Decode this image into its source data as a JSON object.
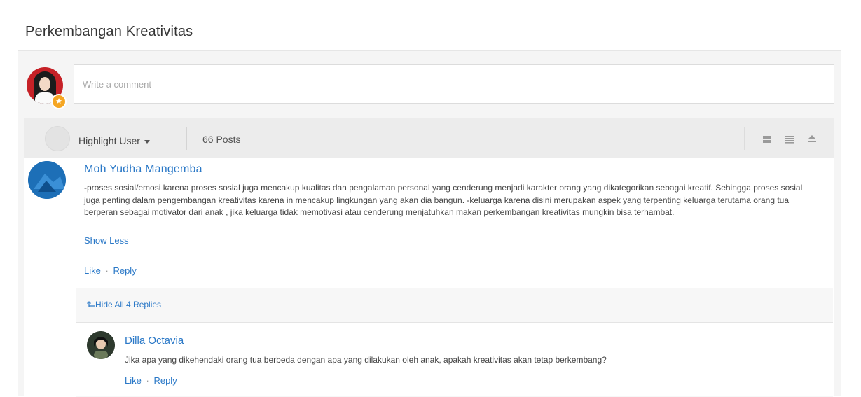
{
  "panel": {
    "title": "Perkembangan Kreativitas"
  },
  "composer": {
    "placeholder": "Write a comment"
  },
  "toolbar": {
    "highlight_label": "Highlight User",
    "posts_count": "66 Posts",
    "view_icons": [
      "list-view-icon",
      "compact-view-icon",
      "collapse-view-icon"
    ]
  },
  "post": {
    "author": "Moh Yudha Mangemba",
    "text": "-proses sosial/emosi karena proses sosial juga mencakup kualitas dan pengalaman personal yang cenderung menjadi karakter orang yang dikategorikan sebagai kreatif. Sehingga proses sosial juga penting dalam pengembangan kreativitas karena in mencakup lingkungan yang akan dia bangun. -keluarga karena disini merupakan aspek yang terpenting keluarga terutama orang tua berperan sebagai motivator dari anak , jika keluarga tidak memotivasi atau cenderung menjatuhkan makan perkembangan kreativitas mungkin bisa terhambat.",
    "show_less": "Show Less",
    "like": "Like",
    "separator": "·",
    "reply": "Reply"
  },
  "replies": {
    "hide_label": "Hide All 4 Replies",
    "items": [
      {
        "author": "Dilla Octavia",
        "text": "Jika apa yang dikehendaki orang tua berbeda dengan apa yang dilakukan oleh anak, apakah kreativitas akan tetap berkembang?",
        "like": "Like",
        "reply": "Reply"
      }
    ]
  },
  "colors": {
    "link": "#2a78c7",
    "avatar_red": "#c62127",
    "avatar_blue": "#1d6fb7",
    "badge": "#f5a623"
  }
}
